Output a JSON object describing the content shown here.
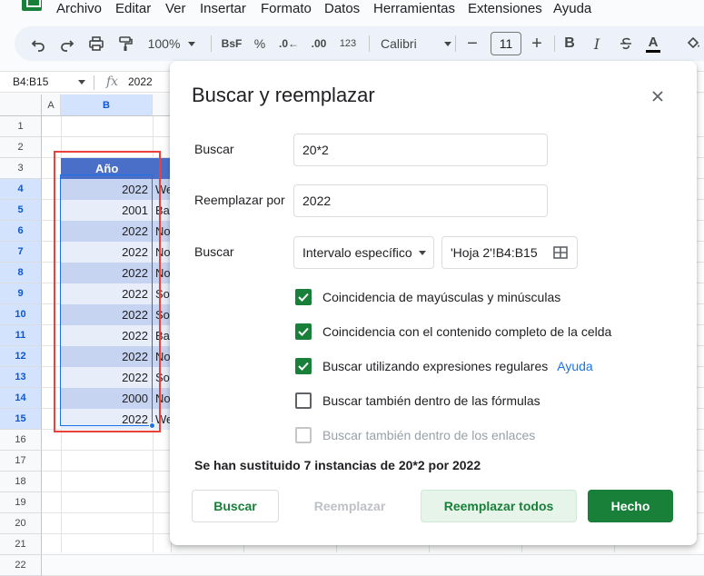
{
  "menu": [
    "Archivo",
    "Editar",
    "Ver",
    "Insertar",
    "Formato",
    "Datos",
    "Herramientas",
    "Extensiones",
    "Ayuda"
  ],
  "toolbar": {
    "zoom": "100%",
    "currency_label": "BsF",
    "percent_label": "%",
    "decimal_decrease_label": ".0←",
    "decimal_increase_label": ".00",
    "format_123_label": "123",
    "font_name": "Calibri",
    "font_size": "11",
    "bold_label": "B",
    "italic_label": "I",
    "text_color_label": "A",
    "text_color": "#000000"
  },
  "formula_bar": {
    "name_box": "B4:B15",
    "fx_label": "fx",
    "value": "2022"
  },
  "sheet": {
    "columns": [
      "A",
      "B"
    ],
    "rows": [
      "1",
      "2",
      "3",
      "4",
      "5",
      "6",
      "7",
      "8",
      "9",
      "10",
      "11",
      "12",
      "13",
      "14",
      "15",
      "16",
      "17",
      "18",
      "19",
      "20",
      "21",
      "22"
    ],
    "header_label": "Año",
    "b_values": [
      "2022",
      "2001",
      "2022",
      "2022",
      "2022",
      "2022",
      "2022",
      "2022",
      "2022",
      "2022",
      "2000",
      "2022"
    ],
    "c_values": [
      "We",
      "Ba",
      "No",
      "No",
      "No",
      "So",
      "So",
      "Ba",
      "No",
      "So",
      "No",
      "We"
    ],
    "header_color": "#4a6fc9",
    "band_dark": "#c6d4f1",
    "band_light": "#e7eefa"
  },
  "dialog": {
    "title": "Buscar y reemplazar",
    "find_label": "Buscar",
    "find_value": "20*2",
    "replace_label": "Reemplazar por",
    "replace_value": "2022",
    "search_label": "Buscar",
    "search_scope": "Intervalo específico",
    "range_value": "'Hoja 2'!B4:B15",
    "checkboxes": [
      {
        "label": "Coincidencia de mayúsculas y minúsculas",
        "state": "checked"
      },
      {
        "label": "Coincidencia con el contenido completo de la celda",
        "state": "checked"
      },
      {
        "label": "Buscar utilizando expresiones regulares",
        "state": "checked"
      },
      {
        "label": "Buscar también dentro de las fórmulas",
        "state": "unchecked"
      },
      {
        "label": "Buscar también dentro de los enlaces",
        "state": "disabled"
      }
    ],
    "help_link": "Ayuda",
    "status": "Se han sustituido 7 instancias de 20*2 por 2022",
    "buttons": {
      "find": "Buscar",
      "replace": "Reemplazar",
      "replace_all": "Reemplazar todos",
      "done": "Hecho"
    },
    "accent_color": "#188038"
  }
}
